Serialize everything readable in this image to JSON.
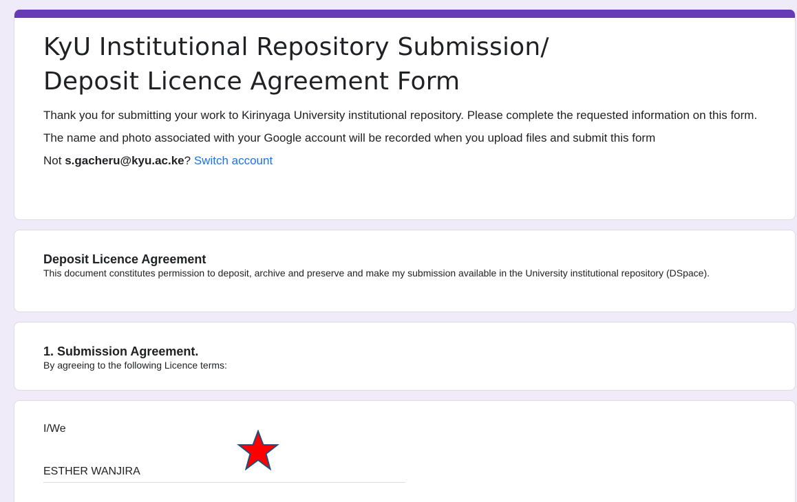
{
  "form": {
    "title_line1": "KyU Institutional Repository Submission/",
    "title_line2": "Deposit Licence Agreement Form",
    "description": "Thank you for submitting your work to Kirinyaga University institutional repository. Please complete the requested information on this form.",
    "notice": "The name and photo associated with your Google account will be recorded when you upload files and submit this form",
    "account_prefix": "Not ",
    "account_email": "s.gacheru@kyu.ac.ke",
    "account_suffix": "? ",
    "switch_account": "Switch account",
    "accent_color": "#673ab7",
    "link_color": "#1a73e8"
  },
  "sections": [
    {
      "title": "Deposit Licence Agreement",
      "description": "This document constitutes permission to deposit, archive and preserve and make my submission available in the University institutional repository (DSpace)."
    },
    {
      "title": "1. Submission Agreement.",
      "description": "By agreeing to the following Licence terms:"
    }
  ],
  "question": {
    "label": "I/We",
    "value": "ESTHER WANJIRA",
    "marker_icon": "star-icon",
    "marker_color": "#ff0000"
  }
}
